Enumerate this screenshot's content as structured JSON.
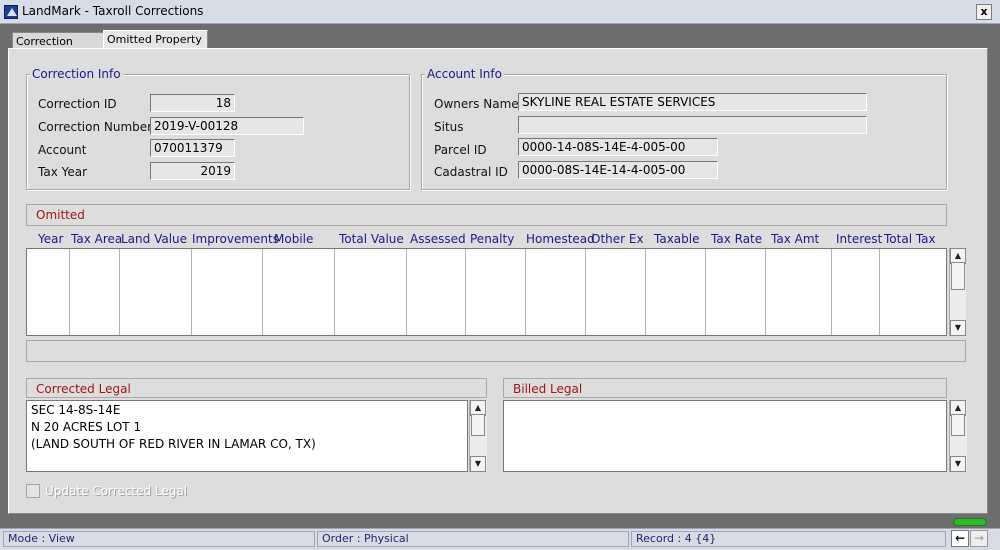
{
  "window": {
    "title": "LandMark - Taxroll Corrections",
    "close_label": "x"
  },
  "tabs": [
    {
      "label": "Correction Data"
    },
    {
      "label": "Omitted Property"
    }
  ],
  "correction_info": {
    "title": "Correction Info",
    "correction_id_label": "Correction ID",
    "correction_id": "18",
    "correction_number_label": "Correction Number",
    "correction_number": "2019-V-00128",
    "account_label": "Account",
    "account": "070011379",
    "tax_year_label": "Tax Year",
    "tax_year": "2019"
  },
  "account_info": {
    "title": "Account Info",
    "owners_name_label": "Owners Name",
    "owners_name": "SKYLINE REAL ESTATE SERVICES",
    "situs_label": "Situs",
    "situs": "",
    "parcel_id_label": "Parcel ID",
    "parcel_id": "0000-14-08S-14E-4-005-00",
    "cadastral_id_label": "Cadastral ID",
    "cadastral_id": "0000-08S-14E-14-4-005-00"
  },
  "omitted": {
    "title": "Omitted",
    "columns": [
      "Year",
      "Tax Area",
      "Land Value",
      "Improvements",
      "Mobile",
      "Total Value",
      "Assessed",
      "Penalty",
      "Homestead",
      "Other Ex",
      "Taxable",
      "Tax Rate",
      "Tax Amt",
      "Interest",
      "Total Tax"
    ]
  },
  "corrected_legal": {
    "title": "Corrected Legal",
    "text": "SEC 14-8S-14E\nN 20 ACRES LOT 1\n(LAND SOUTH OF RED RIVER IN LAMAR CO, TX)"
  },
  "billed_legal": {
    "title": "Billed Legal",
    "text": ""
  },
  "update_checkbox": {
    "label": "Update Corrected Legal",
    "checked": false
  },
  "status": {
    "mode": "Mode : View",
    "order": "Order : Physical",
    "record": "Record : 4 {4}"
  },
  "icons": {
    "scroll_up": "scroll-up-icon",
    "scroll_down": "scroll-down-icon",
    "nav_back": "arrow-left-icon",
    "nav_forward": "arrow-right-icon"
  },
  "colors": {
    "group_title": "#1a1a8a",
    "omitted_title": "#a21515",
    "indicator": "#2fb82f"
  }
}
